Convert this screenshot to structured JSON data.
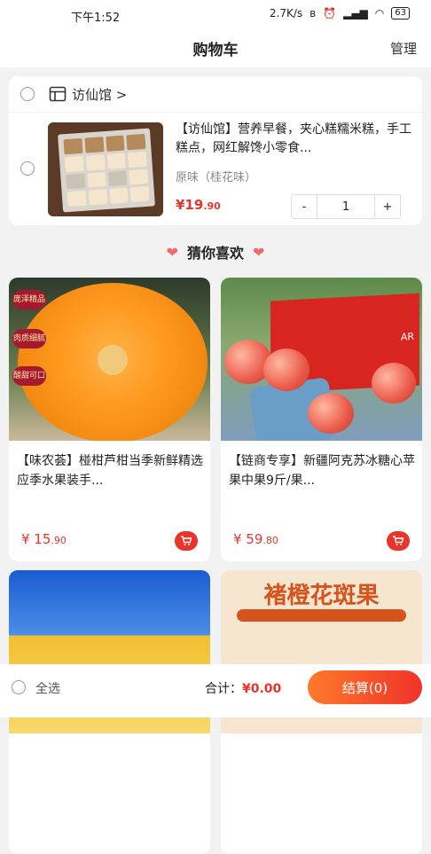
{
  "status_bar": {
    "time": "下午1:52",
    "network_speed": "2.7K/s",
    "battery": "63"
  },
  "header": {
    "title": "购物车",
    "manage": "管理"
  },
  "cart": {
    "shop_name": "访仙馆 >",
    "item": {
      "title": "【访仙馆】营养早餐，夹心糕糯米糕，手工糕点，网红解馋小零食...",
      "spec": "原味（桂花味）",
      "price_int": "¥19",
      "price_dec": ".90",
      "minus": "-",
      "quantity": "1",
      "plus": "+"
    }
  },
  "recommend": {
    "title": "猜你喜欢",
    "products": [
      {
        "title": "【味农荟】椪柑芦柑当季新鲜精选应季水果装手...",
        "price_int": "¥ 15",
        "price_dec": ".90",
        "badges": [
          "庞泽精品",
          "肉质细腻",
          "酸甜可口"
        ]
      },
      {
        "title": "【链商专享】新疆阿克苏冰糖心苹果中果9斤/果...",
        "price_int": "¥ 59",
        "price_dec": ".80",
        "box_label": "AR"
      },
      {
        "title": "",
        "price_int": "",
        "price_dec": ""
      },
      {
        "title": "",
        "price_int": "",
        "price_dec": "",
        "banner": "褚橙花斑果"
      }
    ]
  },
  "bottom_bar": {
    "select_all": "全选",
    "total_label": "合计：",
    "total_value": "¥0.00",
    "checkout": "结算(0)"
  },
  "colors": {
    "accent": "#e8342a",
    "checkout_start": "#ff7a2a",
    "checkout_end": "#f0322a"
  }
}
